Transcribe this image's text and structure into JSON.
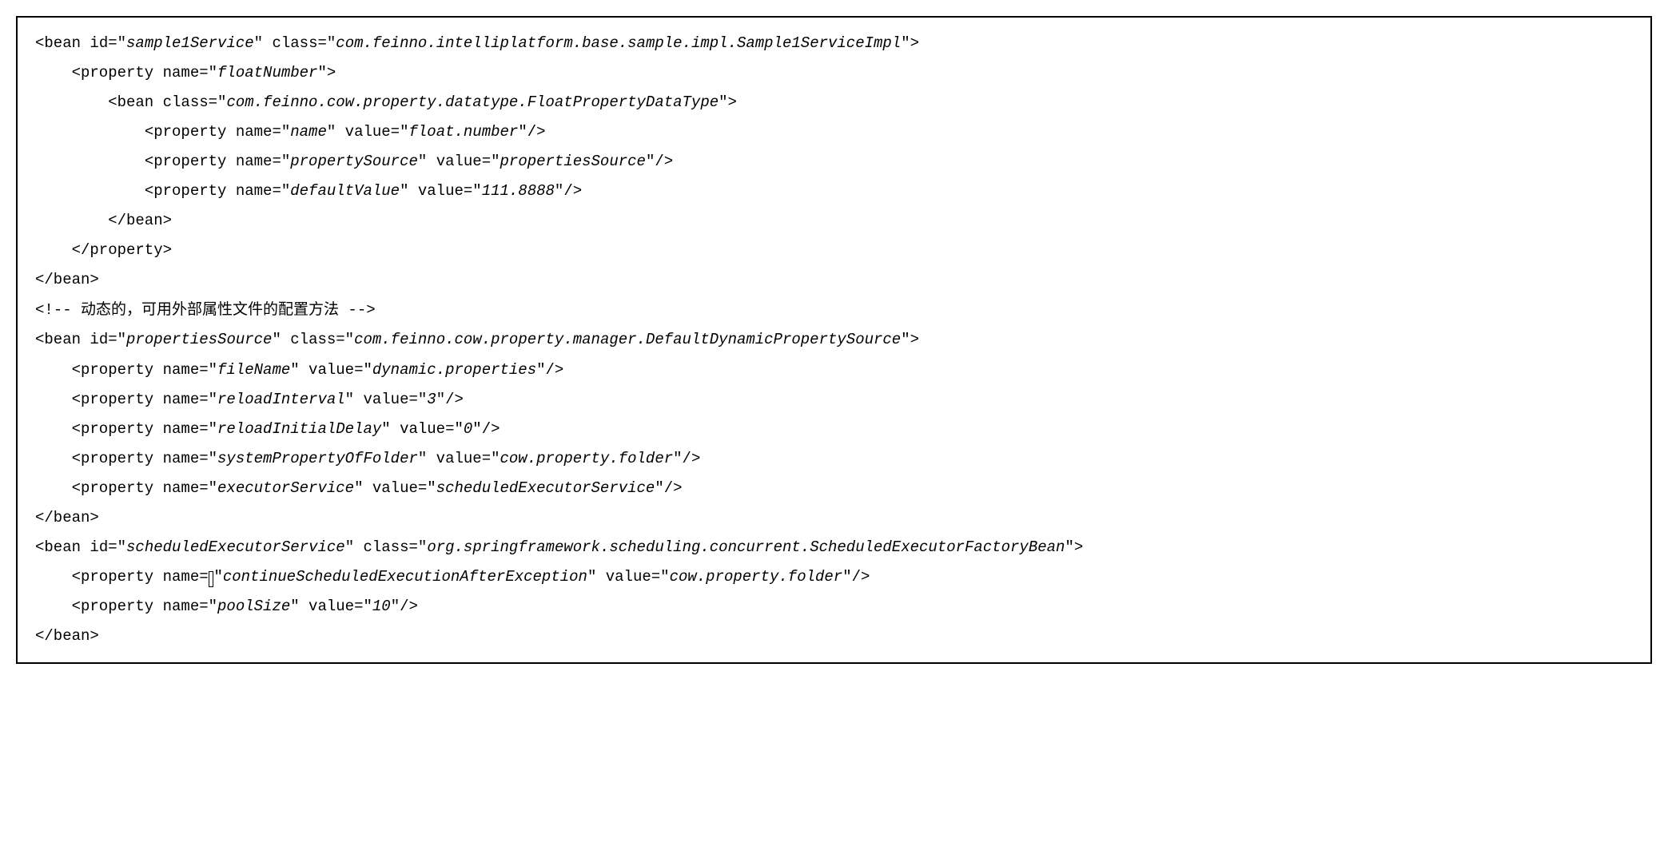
{
  "bean1": {
    "open_prefix": "<bean id=\"",
    "id": "sample1Service",
    "mid": "\" class=\"",
    "cls": "com.feinno.intelliplatform.base.sample.impl.Sample1ServiceImpl",
    "suffix": "\">",
    "prop_open_prefix": "<property name=\"",
    "prop_open_name": "floatNumber",
    "prop_open_suffix": "\">",
    "inner_bean_prefix": "<bean class=\"",
    "inner_bean_cls": "com.feinno.cow.property.datatype.FloatPropertyDataType",
    "inner_bean_suffix": "\">",
    "p_prefix": "<property name=\"",
    "p1_name": "name",
    "p_mid": "\" value=\"",
    "p1_val": "float.number",
    "p_suffix": "\"/>",
    "p2_name": "propertySource",
    "p2_val": "propertiesSource",
    "p3_name": "defaultValue",
    "p3_val": "111.8888",
    "inner_bean_close": "</bean>",
    "prop_close": "</property>",
    "close": "</bean>"
  },
  "comment": {
    "open": "<!-- ",
    "text": "动态的，可用外部属性文件的配置方法",
    "close": " -->"
  },
  "bean2": {
    "open_prefix": "<bean id=\"",
    "id": "propertiesSource",
    "mid": "\" class=\"",
    "cls": "com.feinno.cow.property.manager.DefaultDynamicPropertySource",
    "suffix": "\">",
    "p_prefix": "<property name=\"",
    "p_mid": "\" value=\"",
    "p_suffix": "\"/>",
    "p1_name": "fileName",
    "p1_val": "dynamic.properties",
    "p2_name": "reloadInterval",
    "p2_val": "3",
    "p3_name": "reloadInitialDelay",
    "p3_val": "0",
    "p4_name": "systemPropertyOfFolder",
    "p4_val": "cow.property.folder",
    "p5_name": "executorService",
    "p5_val": "scheduledExecutorService",
    "close": "</bean>"
  },
  "bean3": {
    "open_prefix": "<bean id=\"",
    "id": "scheduledExecutorService",
    "mid": "\" class=\"",
    "cls": "org.springframework.scheduling.concurrent.ScheduledExecutorFactoryBean",
    "suffix": "\">",
    "p_prefix_a": "<property name=",
    "p_prefix_b": "\"",
    "p_mid": "\" value=\"",
    "p_suffix": "\"/>",
    "p1_name": "continueScheduledExecutionAfterException",
    "p1_val": "cow.property.folder",
    "p_prefix": "<property name=\"",
    "p2_name": "poolSize",
    "p2_val": "10",
    "close": "</bean>"
  }
}
